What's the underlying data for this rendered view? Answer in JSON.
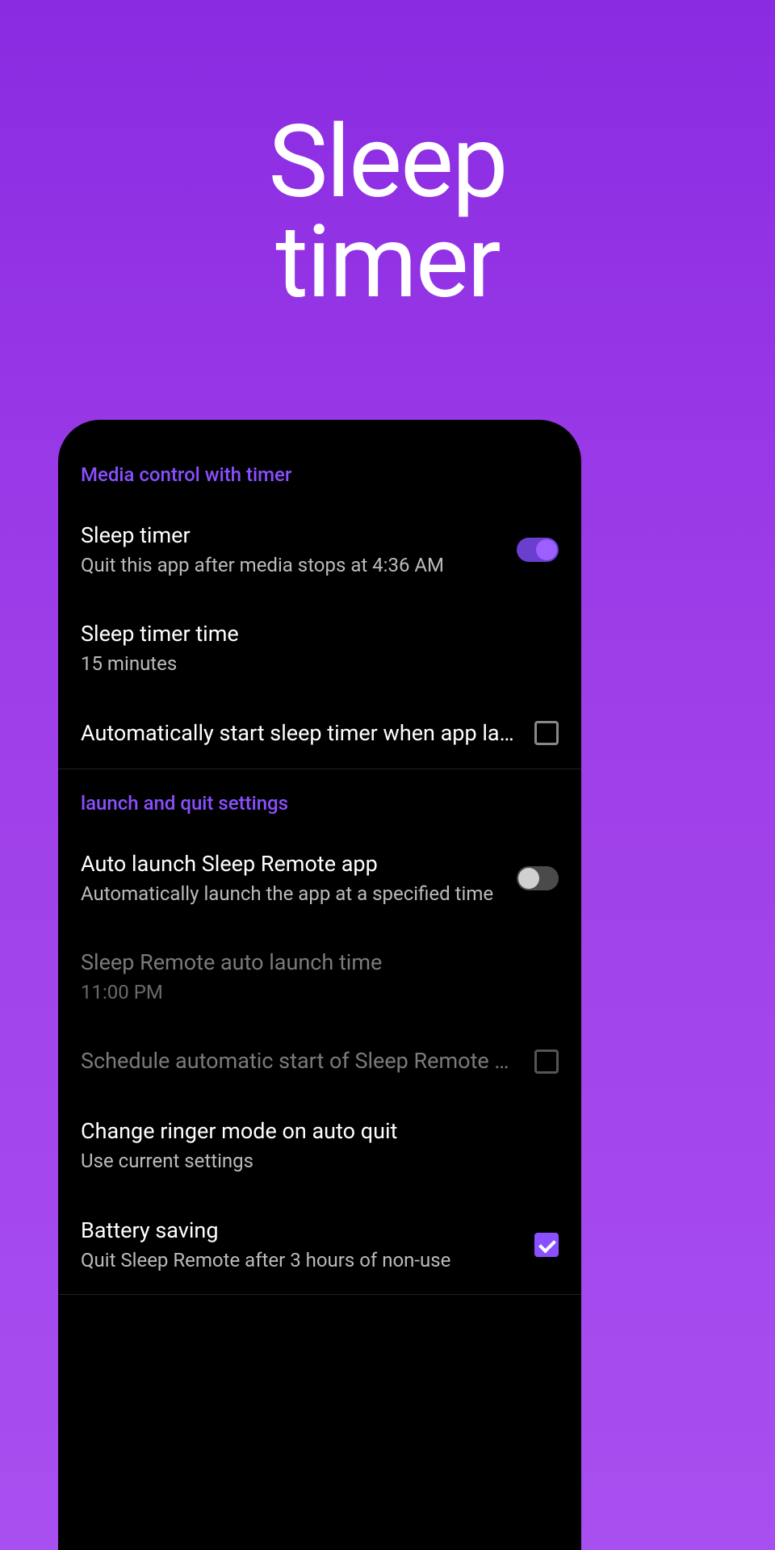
{
  "hero": {
    "line1": "Sleep",
    "line2": "timer"
  },
  "sections": {
    "media": {
      "header": "Media control with timer",
      "sleep_timer": {
        "title": "Sleep timer",
        "subtitle": "Quit this app after media stops at 4:36 AM"
      },
      "sleep_timer_time": {
        "title": "Sleep timer time",
        "subtitle": "15 minutes"
      },
      "auto_start": {
        "title": "Automatically start sleep timer when app lau.."
      }
    },
    "launch": {
      "header": "launch and quit settings",
      "auto_launch": {
        "title": "Auto launch Sleep Remote app",
        "subtitle": "Automatically launch the app at a specified time"
      },
      "auto_launch_time": {
        "title": "Sleep Remote auto launch time",
        "subtitle": "11:00 PM"
      },
      "schedule": {
        "title": "Schedule automatic start of Sleep Remote w.."
      },
      "ringer": {
        "title": "Change ringer mode on auto quit",
        "subtitle": "Use current settings"
      },
      "battery": {
        "title": "Battery saving",
        "subtitle": "Quit Sleep Remote after 3 hours of non-use"
      }
    }
  }
}
